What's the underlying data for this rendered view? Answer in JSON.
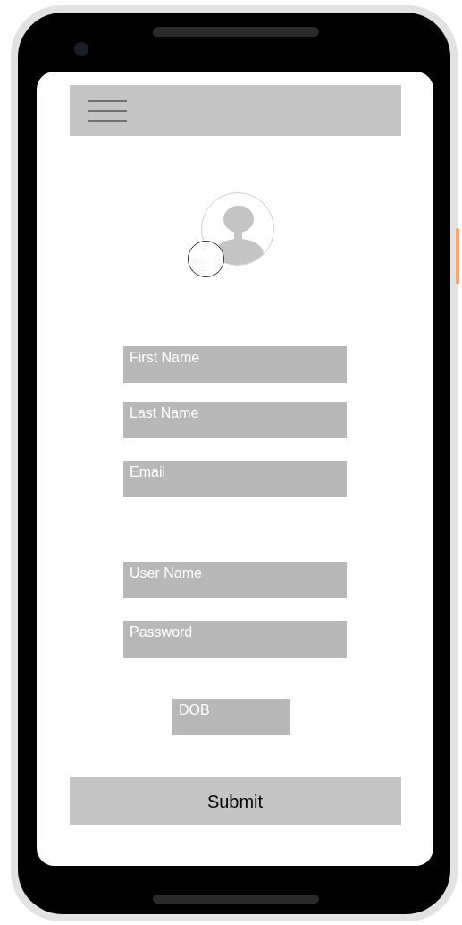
{
  "fields": [
    {
      "placeholder": "First Name",
      "kind": "wide"
    },
    {
      "placeholder": "Last Name",
      "kind": "wide"
    },
    {
      "placeholder": "Email",
      "kind": "wide"
    },
    {
      "placeholder": "User Name",
      "kind": "wide"
    },
    {
      "placeholder": "Password",
      "kind": "wide"
    },
    {
      "placeholder": "DOB",
      "kind": "narrow"
    }
  ],
  "submit": {
    "label": "Submit"
  }
}
